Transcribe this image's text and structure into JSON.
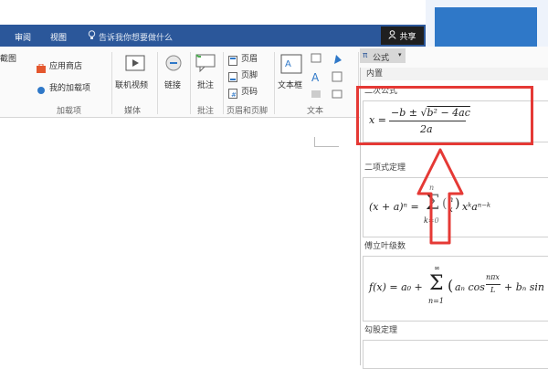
{
  "titlebar": {
    "tabs": [
      "审阅",
      "视图"
    ],
    "tell_me": "告诉我你想要做什么",
    "share": "共享"
  },
  "ribbon": {
    "cut_label": "截图",
    "store_label": "应用商店",
    "my_addins_label": "我的加载项",
    "addins_group": "加载项",
    "online_video_label": "联机视频",
    "media_group": "媒体",
    "link_label": "链接",
    "comment_label": "批注",
    "comment_group": "批注",
    "header_label": "页眉",
    "footer_label": "页脚",
    "page_number_label": "页码",
    "header_footer_group": "页眉和页脚",
    "textbox_label": "文本框",
    "text_group": "文本",
    "equation_label": "公式"
  },
  "gallery": {
    "header": "内置",
    "sections": [
      {
        "title": "二次公式",
        "formula": "x = (−b ± √(b² − 4ac)) / 2a"
      },
      {
        "title": "二项式定理",
        "formula": "(x + a)ⁿ = Σ (n k) xᵏ aⁿ⁻ᵏ"
      },
      {
        "title": "傅立叶级数",
        "formula": "f(x) = a₀ + Σ (aₙ cos nπx/L + bₙ sin nπx/L)"
      },
      {
        "title": "勾股定理",
        "formula": ""
      }
    ]
  },
  "colors": {
    "titlebar": "#2b579a",
    "accent_blue": "#2f78c8",
    "highlight": "#e53935"
  },
  "icons": [
    "lightbulb-icon",
    "person-icon",
    "store-icon",
    "addins-icon",
    "video-icon",
    "link-icon",
    "comment-icon",
    "header-icon",
    "footer-icon",
    "page-number-icon",
    "textbox-icon",
    "equation-icon",
    "arrow-up-icon"
  ]
}
